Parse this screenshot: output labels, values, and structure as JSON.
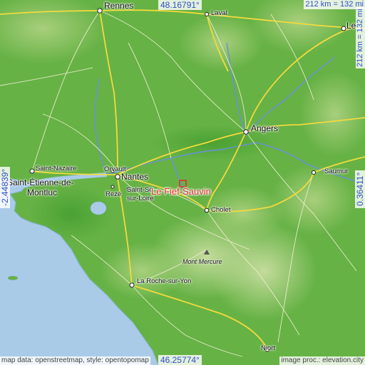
{
  "map": {
    "marker_label": "Le Fief-Sauvin",
    "cities": {
      "rennes": "Rennes",
      "laval": "Laval",
      "le_mans": "Le",
      "angers": "Angers",
      "saumur": "Saumur",
      "cholet": "Cholet",
      "nantes": "Nantes",
      "orvault": "Orvault",
      "reze": "Rezé",
      "saint_sebastien": "Saint-Sé",
      "sur_loire": "sur-Loire",
      "saint_nazaire": "Saint-Nazaire",
      "saint_etienne": "Saint-Étienne-de-",
      "montluc": "Montluc",
      "la_roche": "La Roche-sur-Yon",
      "niort": "Niort"
    },
    "places": {
      "mont_mercure": "Mont Mercure"
    },
    "coords": {
      "top": "48.16791°",
      "bottom": "46.25774°",
      "left": "-2.44839°",
      "right": "0.36411°"
    },
    "scale": {
      "horizontal": "212 km = 132 mi",
      "vertical": "212 km = 132 mi"
    },
    "attribution": {
      "left": "map data: openstreetmap, style: opentopomap",
      "right": "image proc.: elevation.city"
    },
    "colors": {
      "sea": "#a9cbe8",
      "lowland": "#5fae40",
      "upland": "#a9cf7a",
      "road_major": "#f3da3d",
      "road_minor": "#f7f2d6",
      "river": "#6a8fe0",
      "marker": "#e0322a",
      "coord_text": "#2f4fc8"
    }
  }
}
